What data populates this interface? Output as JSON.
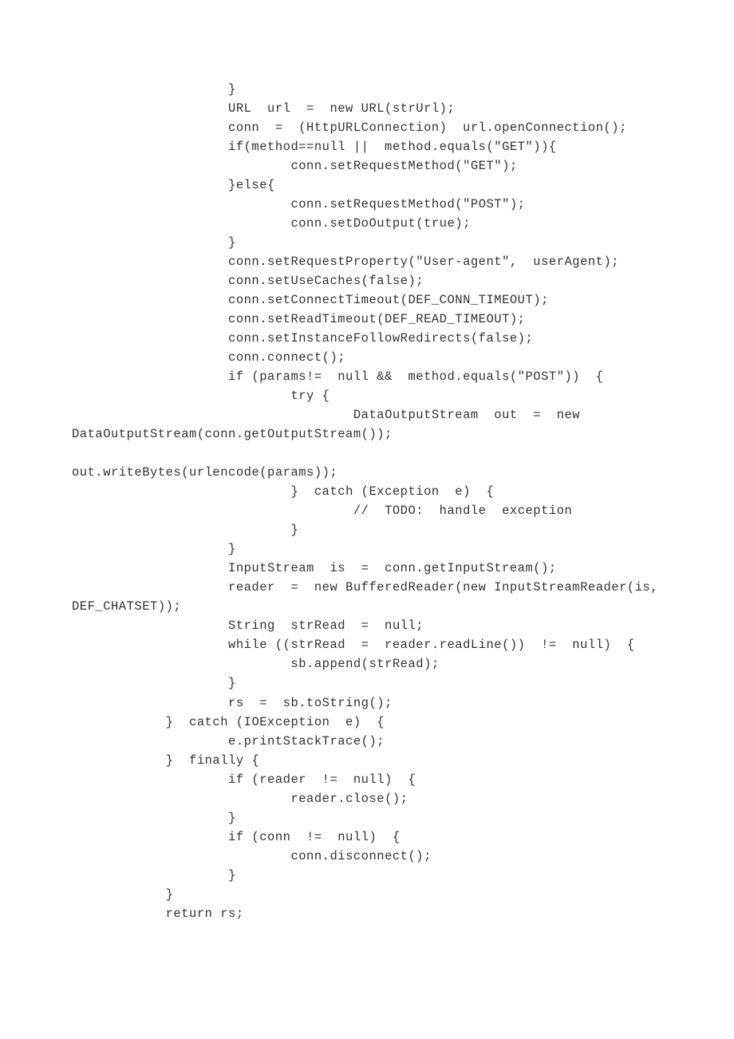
{
  "code": {
    "lines": [
      "                    }",
      "                    URL  url  =  new URL(strUrl);",
      "                    conn  =  (HttpURLConnection)  url.openConnection();",
      "                    if(method==null ||  method.equals(\"GET\")){",
      "                            conn.setRequestMethod(\"GET\");",
      "                    }else{",
      "                            conn.setRequestMethod(\"POST\");",
      "                            conn.setDoOutput(true);",
      "                    }",
      "                    conn.setRequestProperty(\"User-agent\",  userAgent);",
      "                    conn.setUseCaches(false);",
      "                    conn.setConnectTimeout(DEF_CONN_TIMEOUT);",
      "                    conn.setReadTimeout(DEF_READ_TIMEOUT);",
      "                    conn.setInstanceFollowRedirects(false);",
      "                    conn.connect();",
      "                    if (params!=  null &&  method.equals(\"POST\"))  {",
      "                            try {",
      "                                    DataOutputStream  out  =  new DataOutputStream(conn.getOutputStream());",
      "                                            out.writeBytes(urlencode(params));",
      "                            }  catch (Exception  e)  {",
      "                                    //  TODO:  handle  exception",
      "                            }",
      "                    }",
      "                    InputStream  is  =  conn.getInputStream();",
      "                    reader  =  new BufferedReader(new InputStreamReader(is,  DEF_CHATSET));",
      "                    String  strRead  =  null;",
      "                    while ((strRead  =  reader.readLine())  !=  null)  {",
      "                            sb.append(strRead);",
      "                    }",
      "                    rs  =  sb.toString();",
      "            }  catch (IOException  e)  {",
      "                    e.printStackTrace();",
      "            }  finally {",
      "                    if (reader  !=  null)  {",
      "                            reader.close();",
      "                    }",
      "                    if (conn  !=  null)  {",
      "                            conn.disconnect();",
      "                    }",
      "            }",
      "            return rs;"
    ]
  }
}
